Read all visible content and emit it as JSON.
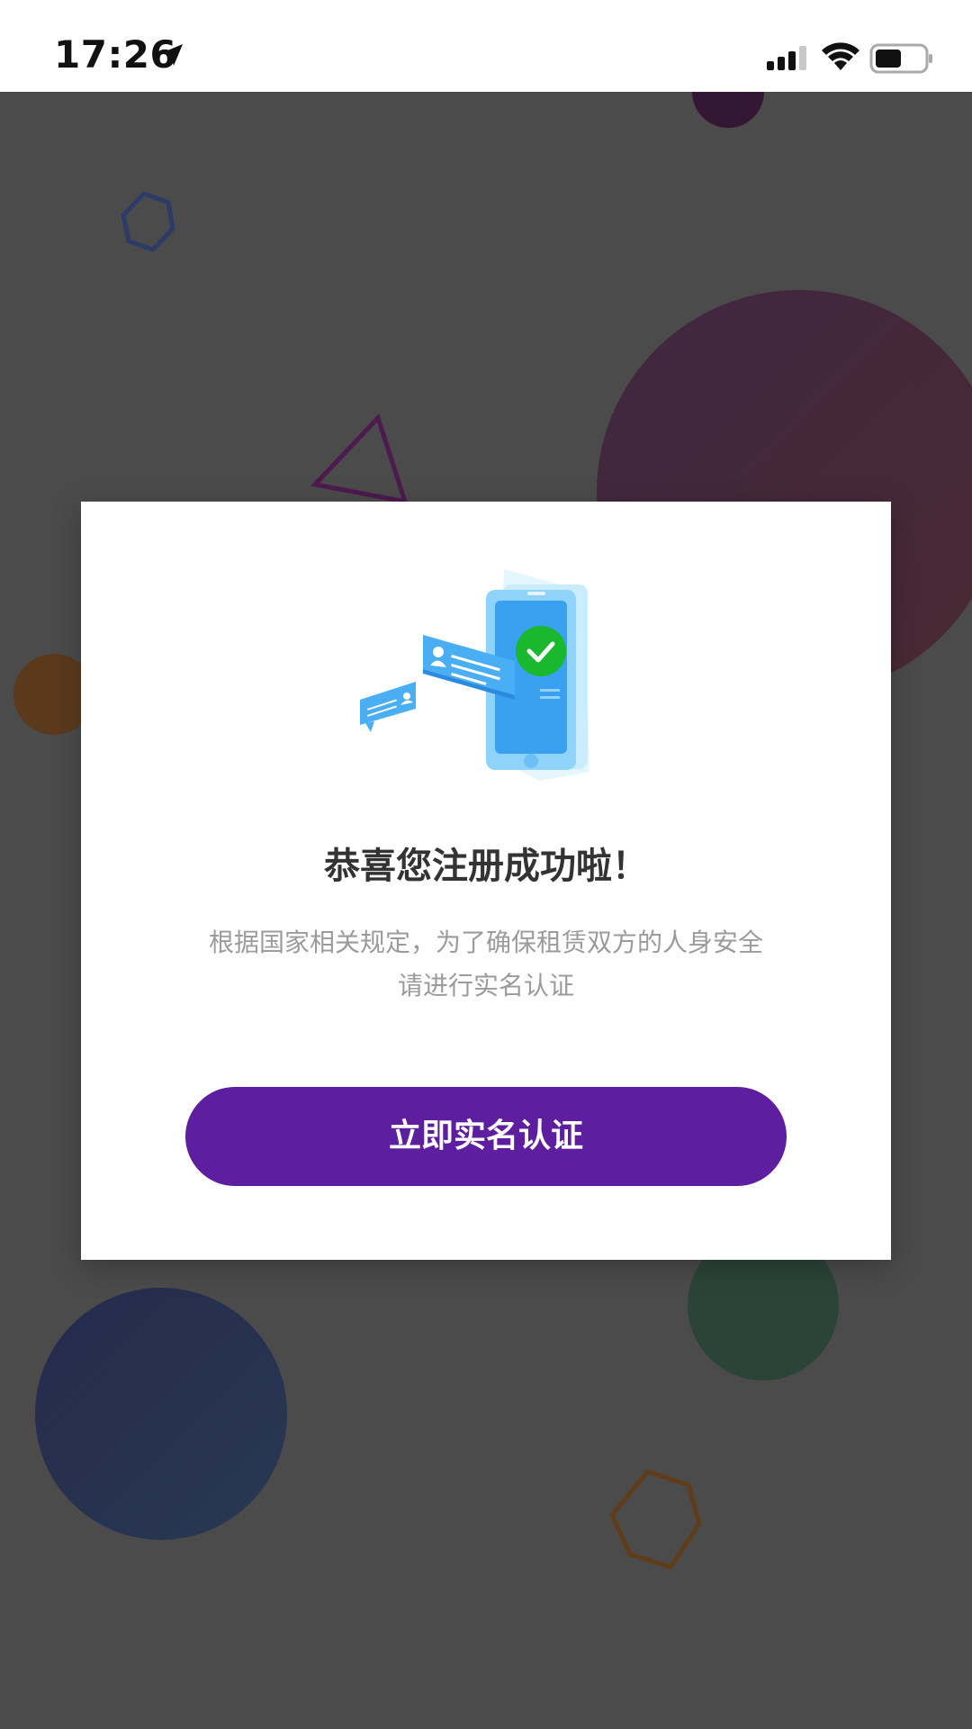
{
  "status_bar": {
    "time": "17:26",
    "icons": [
      "location-arrow-icon",
      "cellular-signal-icon",
      "wifi-icon",
      "battery-icon"
    ]
  },
  "modal": {
    "illustration": "phone-verification-illustration",
    "title": "恭喜您注册成功啦！",
    "description_line1": "根据国家相关规定，为了确保租赁双方的人身安全",
    "description_line2": "请进行实名认证",
    "button_label": "立即实名认证"
  },
  "colors": {
    "accent": "#5e1ea0",
    "overlay": "#4b4b4b",
    "success": "#19b82f",
    "card_blue": "#3aa0f0"
  }
}
